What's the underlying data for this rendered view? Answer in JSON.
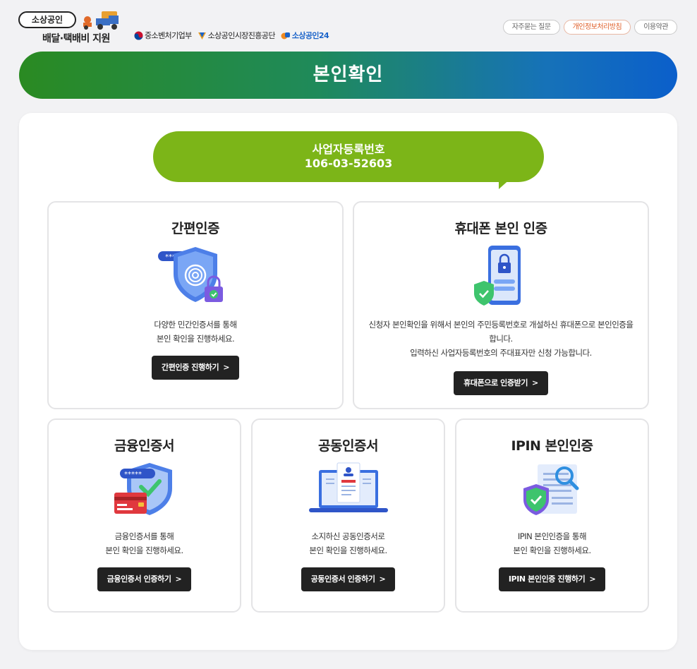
{
  "header": {
    "logo_pill": "소상공인",
    "logo_sub": "배달·택배비 지원",
    "orgs": [
      "중소벤처기업부",
      "소상공인시장진흥공단",
      "소상공인24"
    ],
    "links": [
      "자주묻는 질문",
      "개인정보처리방침",
      "이용약관"
    ]
  },
  "banner": {
    "title": "본인확인"
  },
  "business": {
    "label": "사업자등록번호",
    "number": "106-03-52603"
  },
  "cards": {
    "simple": {
      "title": "간편인증",
      "desc1": "다양한 민간인증서를 통해",
      "desc2": "본인 확인을 진행하세요.",
      "button": "간편인증 진행하기"
    },
    "phone": {
      "title": "휴대폰 본인 인증",
      "desc1": "신청자 본인확인을 위해서 본인의 주민등록번호로 개설하신 휴대폰으로 본인인증을",
      "desc2": "합니다.",
      "desc3": "입력하신 사업자등록번호의 주대표자만 신청 가능합니다.",
      "button": "휴대폰으로 인증받기"
    },
    "finance": {
      "title": "금융인증서",
      "desc1": "금융인증서를 통해",
      "desc2": "본인 확인을 진행하세요.",
      "button": "금융인증서 인증하기"
    },
    "joint": {
      "title": "공동인증서",
      "desc1": "소지하신 공동인증서로",
      "desc2": "본인 확인을 진행하세요.",
      "button": "공동인증서 인증하기"
    },
    "ipin": {
      "title": "IPIN 본인인증",
      "desc1": "IPIN 본인인증을 통해",
      "desc2": "본인 확인을 진행하세요.",
      "button": "IPIN 본인인증 진행하기"
    }
  },
  "colors": {
    "banner_start": "#2a8a22",
    "banner_end": "#0b5fcb",
    "bubble": "#7cb518",
    "button": "#222222",
    "accent_link": "#e0602a"
  },
  "icons": [
    "fingerprint-shield-icon",
    "phone-lock-icon",
    "card-shield-icon",
    "laptop-certificate-icon",
    "document-search-shield-icon",
    "chevron-right-icon"
  ]
}
